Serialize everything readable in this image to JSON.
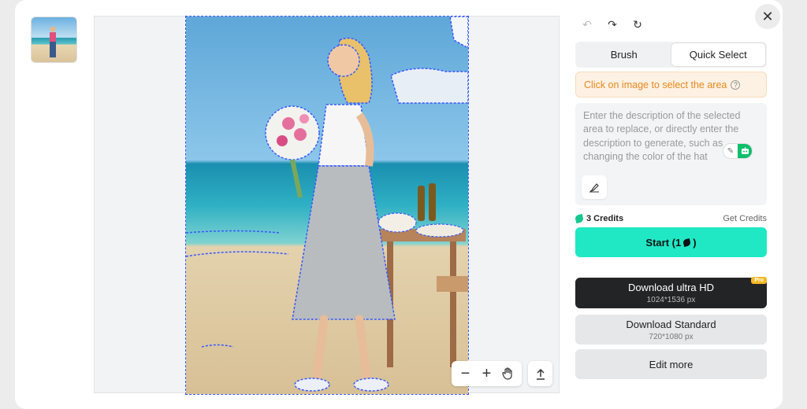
{
  "editor": {
    "close_icon": "close-icon",
    "history": {
      "undo_icon": "undo-icon",
      "redo_icon": "redo-icon",
      "reset_icon": "refresh-icon"
    }
  },
  "tabs": [
    {
      "label": "Brush",
      "active": false
    },
    {
      "label": "Quick Select",
      "active": true
    }
  ],
  "notice": {
    "text": "Click on image to select the area",
    "icon": "help-circle-icon"
  },
  "prompt": {
    "placeholder": "Enter the description of the selected area to replace, or directly enter the description to generate, such as changing the color of the hat",
    "icons": [
      "eraser-icon",
      "robot-icon",
      "brush-icon"
    ]
  },
  "credits": {
    "label": "3 Credits",
    "link": "Get Credits"
  },
  "start": {
    "label": "Start (1",
    "suffix": ")"
  },
  "download_hd": {
    "title": "Download ultra HD",
    "size": "1024*1536 px",
    "badge": "Pro"
  },
  "download_std": {
    "title": "Download Standard",
    "size": "720*1080 px"
  },
  "edit_more": {
    "label": "Edit more"
  },
  "zoom": {
    "icons": [
      "zoom-out-icon",
      "zoom-in-icon",
      "hand-icon",
      "upload-icon"
    ]
  },
  "colors": {
    "accent": "#20e8c5",
    "selection": "#3659ff",
    "notice": "#e8891d"
  }
}
